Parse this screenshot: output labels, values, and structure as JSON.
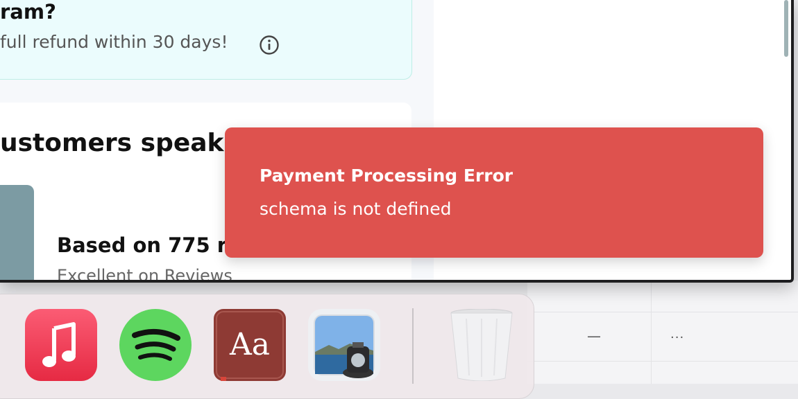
{
  "guarantee": {
    "title": "ram?",
    "text": "full refund within 30 days!"
  },
  "reviews": {
    "heading": "ustomers speak",
    "based_on": "Based on 775 r",
    "excellent": "Excellent on Reviews"
  },
  "toast": {
    "title": "Payment Processing Error",
    "message": "schema is not defined"
  },
  "desktop_table": {
    "dash": "—",
    "more": "···"
  },
  "dock": {
    "apps": [
      "Music",
      "Spotify",
      "Dictionary",
      "Preview"
    ],
    "trash": "Trash"
  }
}
